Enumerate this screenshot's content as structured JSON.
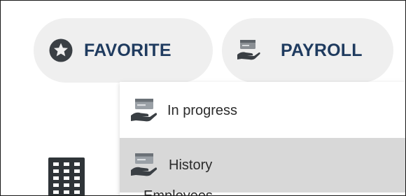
{
  "favorite_button": {
    "label": "FAVORITE",
    "icon": "star-circle-icon"
  },
  "payroll_button": {
    "label": "PAYROLL",
    "icon": "payroll-icon"
  },
  "payroll_menu": {
    "items": [
      {
        "label": "In progress",
        "icon": "hand-money-icon",
        "highlighted": false
      },
      {
        "label": "History",
        "icon": "hand-money-icon",
        "highlighted": true
      }
    ],
    "partial_next_label": "Employees"
  },
  "side_icon": "building-icon",
  "colors": {
    "pill_background": "#efefef",
    "pill_text": "#1f3b5f",
    "menu_highlight": "#d8d8d8",
    "icon_dark": "#3a3f44"
  }
}
